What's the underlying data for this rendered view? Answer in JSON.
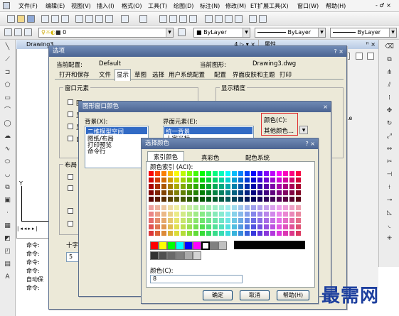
{
  "menubar": {
    "items": [
      "文件(F)",
      "编辑(E)",
      "视图(V)",
      "插入(I)",
      "格式(O)",
      "工具(T)",
      "绘图(D)",
      "标注(N)",
      "修改(M)",
      "ET扩展工具(X)",
      "窗口(W)",
      "帮助(H)"
    ],
    "win_controls": "- ♂ ×"
  },
  "layer_toolbar": {
    "layer_value": "0",
    "color_value": "■ ByLayer",
    "linetype_value": "ByLayer",
    "lineweight_value": "ByLayer"
  },
  "drawing": {
    "tab_title": "Drawing3",
    "tab_controls": "4 ▷ ▾ ×",
    "y_axis": "Y",
    "x_axis": "X"
  },
  "props_panel": {
    "title": "属性",
    "controls": "ꟸ ×",
    "side_label": "Le"
  },
  "command_lines": [
    "命令:",
    "命令:",
    "命令:",
    "命令:",
    "自动保",
    "命令:"
  ],
  "options_dialog": {
    "title": "选项",
    "current_profile_label": "当前配置:",
    "current_profile_value": "Default",
    "current_drawing_label": "当前图形:",
    "current_drawing_value": "Drawing3.dwg",
    "tabs": [
      "打开和保存",
      "文件",
      "显示",
      "草图",
      "选择",
      "用户系统配置",
      "配置",
      "界面皮肤和主题",
      "打印"
    ],
    "window_elements_label": "窗口元素",
    "display_precision_label": "显示精度",
    "checkbox_labels": [
      "图",
      "显",
      "显",
      "自"
    ],
    "layout_label": "布局",
    "crosshair_label": "十字光标大小(Z)",
    "crosshair_value": "5",
    "title_buttons": "? ×"
  },
  "window_colors_dialog": {
    "title": "图形窗口颜色",
    "context_label": "背景(X):",
    "context_items": [
      "二维模型空间",
      "图纸/布局",
      "打印预览",
      "命令行"
    ],
    "element_label": "界面元素(E):",
    "element_items": [
      "统一背景",
      "十字光标"
    ],
    "color_label": "颜色(C):",
    "color_value": "其他颜色..."
  },
  "select_color_dialog": {
    "title": "选择颜色",
    "title_buttons": "? ×",
    "tabs": [
      "索引颜色",
      "真彩色",
      "配色系统"
    ],
    "aci_label": "颜色索引 (ACI):",
    "color_field_label": "颜色(C):",
    "color_field_value": "8",
    "ok_label": "确定",
    "cancel_label": "取消",
    "help_label": "帮助(H)"
  },
  "watermark": "最需网",
  "colors": {
    "title_bar": "#4b6492",
    "dialog_bg": "#ece9d8",
    "selection": "#316ac5",
    "highlight_box": "#e03030",
    "watermark": "#1d3f9e"
  }
}
